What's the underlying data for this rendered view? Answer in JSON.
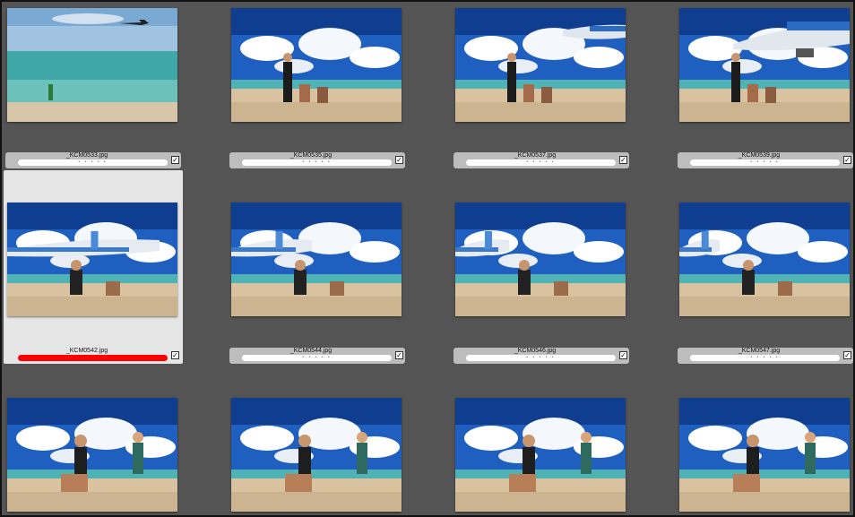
{
  "rows": [
    [
      {
        "filename": "_KCM0533.jpg",
        "rating": "• • • • •",
        "checked": "✓",
        "label_color": "",
        "scene": "ocean"
      },
      {
        "filename": "_KCM0535.jpg",
        "rating": "• • • • •",
        "checked": "✓",
        "label_color": "",
        "scene": "beach-jump"
      },
      {
        "filename": "_KCM0537.jpg",
        "rating": "• • • • •",
        "checked": "✓",
        "label_color": "",
        "scene": "beach-jump-plane"
      },
      {
        "filename": "_KCM0539.jpg",
        "rating": "• • • • •",
        "checked": "✓",
        "label_color": "",
        "scene": "beach-jump-plane-big"
      }
    ],
    [
      {
        "filename": "_KCM0542.jpg",
        "rating": "• • • • •",
        "checked": "✓",
        "label_color": "#ff0000",
        "scene": "plane-left",
        "selected": true
      },
      {
        "filename": "_KCM0544.jpg",
        "rating": "• • • • •",
        "checked": "✓",
        "label_color": "",
        "scene": "plane-mid"
      },
      {
        "filename": "_KCM0546.jpg",
        "rating": "• • • • •",
        "checked": "✓",
        "label_color": "",
        "scene": "plane-far"
      },
      {
        "filename": "_KCM0547.jpg",
        "rating": "• • • • •",
        "checked": "✓",
        "label_color": "",
        "scene": "plane-far2"
      }
    ],
    [
      {
        "filename": "",
        "rating": "",
        "checked": "",
        "label_color": "",
        "scene": "kids-1"
      },
      {
        "filename": "",
        "rating": "",
        "checked": "",
        "label_color": "",
        "scene": "kids-2"
      },
      {
        "filename": "",
        "rating": "",
        "checked": "",
        "label_color": "",
        "scene": "kids-3"
      },
      {
        "filename": "",
        "rating": "",
        "checked": "",
        "label_color": "",
        "scene": "kids-4"
      }
    ]
  ],
  "colors": {
    "background": "#545454",
    "caption": "#bdbdbd",
    "selected_cell": "#e6e6e6",
    "red_label": "#ff0000",
    "sky": "#1f5fbf",
    "sand": "#d9c2a0",
    "sea": "#4fb3b5"
  }
}
